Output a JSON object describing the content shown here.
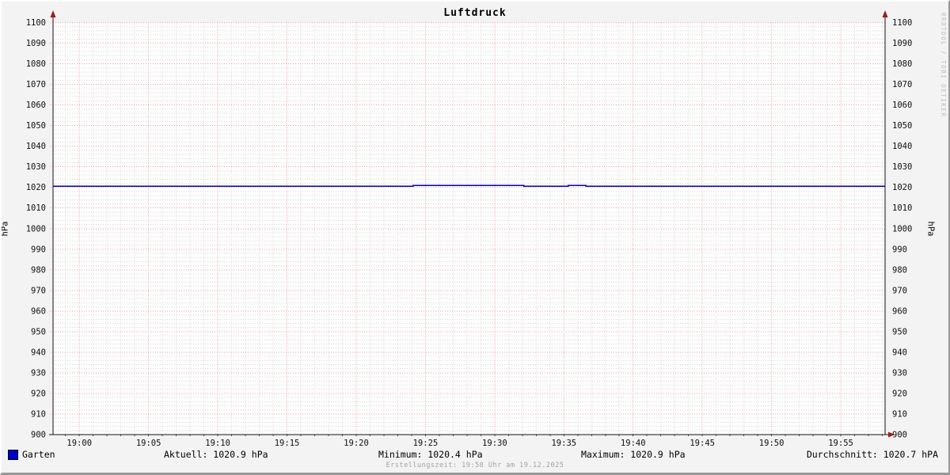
{
  "chart": {
    "title": "Luftdruck",
    "y_axis_label_left": "hPa",
    "y_axis_label_right": "hPa",
    "watermark": "RRDTOOL / TOBI OETIKER",
    "footer": "Erstellungszeit: 19:58 Uhr am 19.12.2025"
  },
  "legend": {
    "series_label": "Garten",
    "series_color": "#0000cc",
    "stats": {
      "aktuell": "Aktuell: 1020.9 hPa",
      "minimum": "Minimum: 1020.4 hPa",
      "maximum": "Maximum: 1020.9 hPa",
      "durchschnitt": "Durchschnitt: 1020.7 hPA"
    }
  },
  "chart_data": {
    "type": "line",
    "title": "Luftdruck",
    "xlabel": "",
    "ylabel": "hPa",
    "ylim": [
      900,
      1100
    ],
    "y_tick_step": 10,
    "y_minor_step": 2,
    "x_tick_labels": [
      "19:00",
      "19:05",
      "19:10",
      "19:15",
      "19:20",
      "19:25",
      "19:30",
      "19:35",
      "19:40",
      "19:45",
      "19:50",
      "19:55"
    ],
    "x_tick_minutes": [
      0,
      5,
      10,
      15,
      20,
      25,
      30,
      35,
      40,
      45,
      50,
      55
    ],
    "x_minor_step_minutes": 1,
    "x_range_minutes": [
      -1.9,
      58.2
    ],
    "grid": true,
    "legend_position": "bottom",
    "series": [
      {
        "name": "Garten",
        "unit": "hPa",
        "color": "#0000c8",
        "step_points_minute_value": [
          [
            -1.9,
            1020.5
          ],
          [
            24.1,
            1020.5
          ],
          [
            24.1,
            1020.9
          ],
          [
            32.1,
            1020.9
          ],
          [
            32.1,
            1020.5
          ],
          [
            35.3,
            1020.5
          ],
          [
            35.3,
            1020.9
          ],
          [
            36.6,
            1020.9
          ],
          [
            36.6,
            1020.5
          ],
          [
            58.2,
            1020.5
          ]
        ]
      }
    ],
    "stats": {
      "aktuell": 1020.9,
      "minimum": 1020.4,
      "maximum": 1020.9,
      "durchschnitt": 1020.7
    },
    "colors": {
      "background": "#f3f3f3",
      "plot_background": "#fdfdfd",
      "major_grid": "#f0a2a2",
      "minor_grid": "#dadada",
      "axis": "#141414",
      "arrow": "#9b1c1c",
      "line": "#0000c8",
      "legend_swatch": "#0000cc"
    }
  }
}
